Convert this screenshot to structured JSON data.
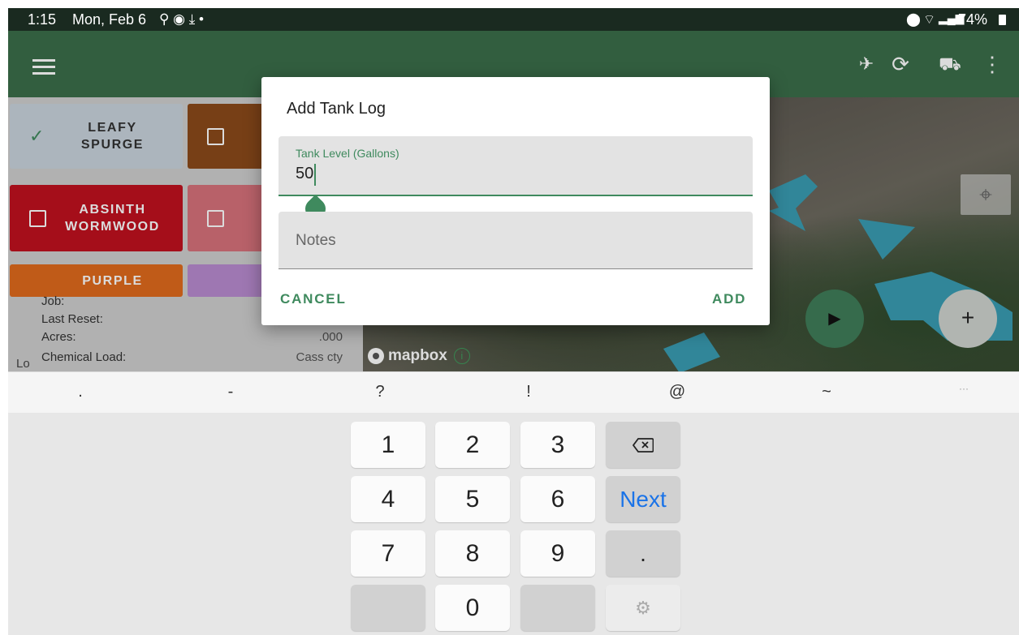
{
  "status_bar": {
    "time": "1:15",
    "date": "Mon, Feb 6",
    "battery": "74%"
  },
  "weed_buttons": [
    {
      "label": "LEAFY\nSPURGE",
      "checked": true,
      "color": "#c9d3dc"
    },
    {
      "label": "",
      "checked": false,
      "color": "#8b4a1a"
    },
    {
      "label": "ABSINTH\nWORMWOOD",
      "checked": false,
      "color": "#c0111f"
    },
    {
      "label": "",
      "checked": false,
      "color": "#d7727b"
    },
    {
      "label": "PURPLE",
      "checked": false,
      "color": "#e06a1c"
    },
    {
      "label": "",
      "checked": false,
      "color": "#b88bd0"
    }
  ],
  "stats": {
    "job_label": "Job:",
    "last_reset_label": "Last Reset:",
    "acres_label": "Acres:",
    "acres_value": ".000",
    "chemical_load_label": "Chemical Load:",
    "chemical_load_value": "Cass cty",
    "left_edge_text": "Lo"
  },
  "map": {
    "attribution": "mapbox",
    "info_glyph": "i"
  },
  "dialog": {
    "title": "Add Tank Log",
    "tank_level_label": "Tank Level (Gallons)",
    "tank_level_value": "50",
    "notes_placeholder": "Notes",
    "cancel_label": "CANCEL",
    "add_label": "ADD"
  },
  "suggestions": [
    ".",
    "-",
    "?",
    "!",
    "@",
    "~",
    "···"
  ],
  "keypad": {
    "k1": "1",
    "k2": "2",
    "k3": "3",
    "k4": "4",
    "k5": "5",
    "k6": "6",
    "k7": "7",
    "k8": "8",
    "k9": "9",
    "k0": "0",
    "dot": ".",
    "next": "Next"
  },
  "colors": {
    "toolbar": "#3b6e4a",
    "accent": "#3f8a5e",
    "next": "#1a73e8"
  }
}
